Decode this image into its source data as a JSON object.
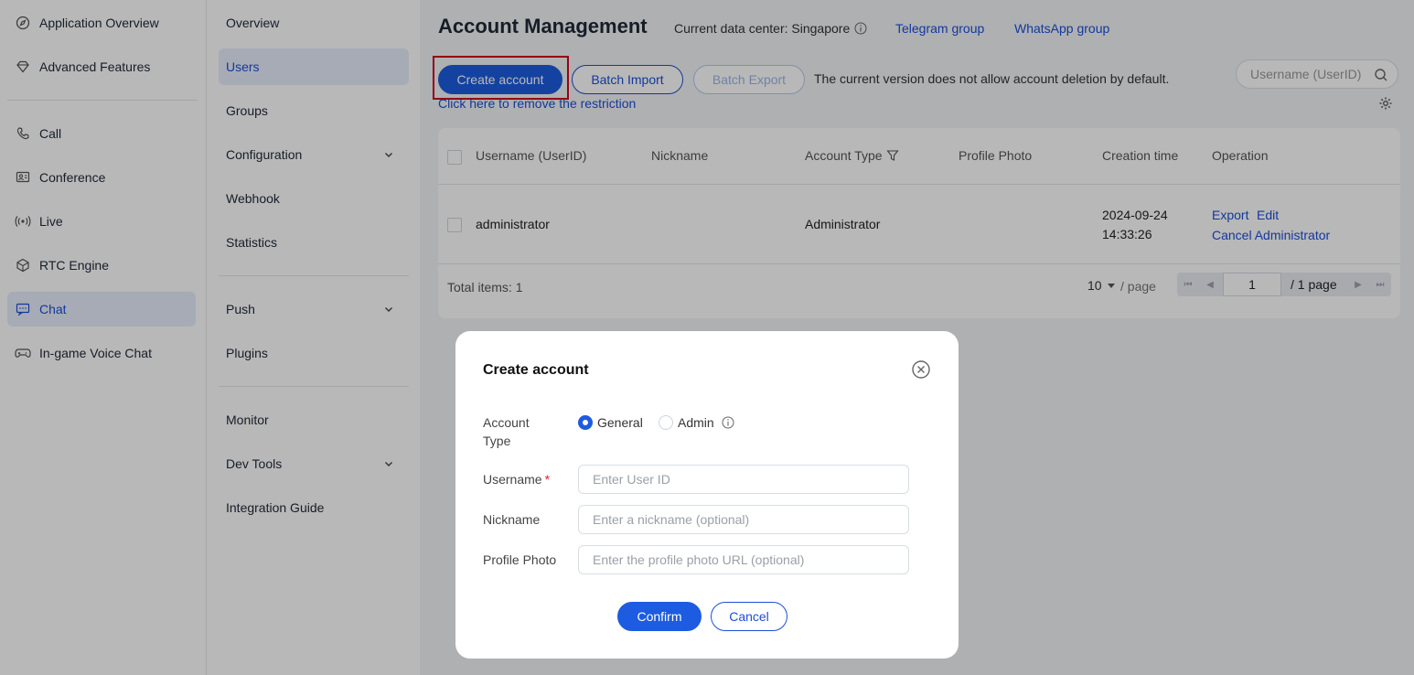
{
  "sidebar1": {
    "items": [
      {
        "label": "Application Overview",
        "icon": "compass-icon"
      },
      {
        "label": "Advanced Features",
        "icon": "diamond-icon"
      },
      {
        "label": "Call",
        "icon": "phone-icon"
      },
      {
        "label": "Conference",
        "icon": "conference-icon"
      },
      {
        "label": "Live",
        "icon": "broadcast-icon"
      },
      {
        "label": "RTC Engine",
        "icon": "cube-icon"
      },
      {
        "label": "Chat",
        "icon": "chat-icon"
      },
      {
        "label": "In-game Voice Chat",
        "icon": "gamepad-icon"
      }
    ],
    "active": "Chat"
  },
  "sidebar2": {
    "items": [
      {
        "label": "Overview"
      },
      {
        "label": "Users"
      },
      {
        "label": "Groups"
      },
      {
        "label": "Configuration"
      },
      {
        "label": "Webhook"
      },
      {
        "label": "Statistics"
      },
      {
        "label": "Push"
      },
      {
        "label": "Plugins"
      },
      {
        "label": "Monitor"
      },
      {
        "label": "Dev Tools"
      },
      {
        "label": "Integration Guide"
      }
    ],
    "active": "Users"
  },
  "header": {
    "title": "Account Management",
    "data_center": "Current data center: Singapore",
    "telegram": "Telegram group",
    "whatsapp": "WhatsApp group"
  },
  "toolbar": {
    "create": "Create account",
    "batch_import": "Batch Import",
    "batch_export": "Batch Export",
    "notice": "The current version does not allow account deletion by default.",
    "restrict_link": "Click here to remove the restriction",
    "search_placeholder": "Username (UserID)"
  },
  "table": {
    "columns": [
      "Username (UserID)",
      "Nickname",
      "Account Type",
      "Profile Photo",
      "Creation time",
      "Operation"
    ],
    "rows": [
      {
        "username": "administrator",
        "nickname": "",
        "account_type": "Administrator",
        "profile_photo": "",
        "creation_date": "2024-09-24",
        "creation_time": "14:33:26",
        "ops": [
          "Export",
          "Edit",
          "Cancel Administrator"
        ]
      }
    ],
    "total": "Total items: 1",
    "page_size": "10",
    "per_page": "/ page",
    "page": "1",
    "page_total": "/ 1 page"
  },
  "modal": {
    "title": "Create account",
    "account_type_label": "Account\nType",
    "options": [
      "General",
      "Admin"
    ],
    "selected": "General",
    "username_label": "Username",
    "username_placeholder": "Enter User ID",
    "nickname_label": "Nickname",
    "nickname_placeholder": "Enter a nickname (optional)",
    "photo_label": "Profile Photo",
    "photo_placeholder": "Enter the profile photo URL (optional)",
    "confirm": "Confirm",
    "cancel": "Cancel"
  },
  "colors": {
    "accent": "#1d5ce0",
    "highlight": "#d0021b",
    "required": "#e02424"
  }
}
